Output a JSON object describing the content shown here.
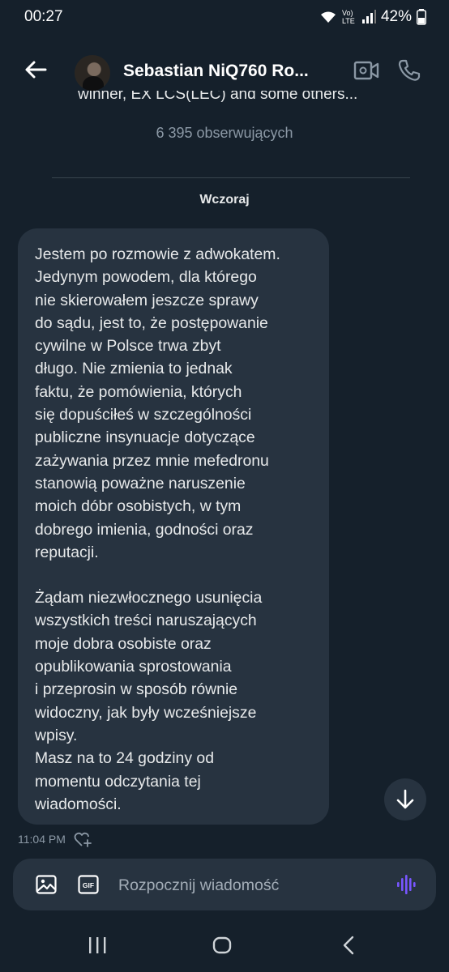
{
  "status_bar": {
    "time": "00:27",
    "network": "Vo) LTE",
    "battery": "42%"
  },
  "header": {
    "name": "Sebastian NiQ760 Ro..."
  },
  "profile": {
    "bio_fragment": "winner, EX LCS(LEC) and some others...",
    "followers": "6 395 obserwujących"
  },
  "conversation": {
    "day_label": "Wczoraj",
    "message": {
      "paragraphs": [
        "Jestem po rozmowie z adwokatem.\nJedynym powodem, dla którego\nnie skierowałem jeszcze sprawy\ndo sądu, jest to, że postępowanie\ncywilne w Polsce trwa zbyt\ndługo. Nie zmienia to jednak\nfaktu, że pomówienia, których\nsię dopuściłeś w szczególności\npubliczne insynuacje dotyczące\nzażywania przez mnie mefedronu\nstanowią poważne naruszenie\nmoich dóbr osobistych, w tym\ndobrego imienia, godności oraz\nreputacji.",
        "Żądam niezwłocznego usunięcia\nwszystkich treści naruszających\nmoje dobra osobiste oraz\nopublikowania sprostowania\ni przeprosin w sposób równie\nwidoczny, jak były wcześniejsze\nwpisy.\nMasz na to 24 godziny od\nmomentu odczytania tej\nwiadomości."
      ],
      "time": "11:04 PM"
    }
  },
  "composer": {
    "placeholder": "Rozpocznij wiadomość",
    "gif_label": "GIF"
  },
  "colors": {
    "background": "#15202b",
    "bubble": "#273340",
    "muted": "#8b98a5",
    "accent_voice": "#7856ff"
  }
}
